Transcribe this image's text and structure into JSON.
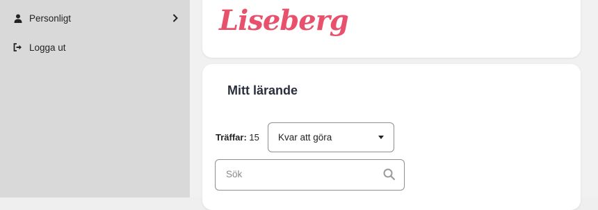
{
  "sidebar": {
    "items": [
      {
        "label": "Personligt",
        "icon": "user-icon"
      },
      {
        "label": "Logga ut",
        "icon": "sign-out-icon"
      }
    ]
  },
  "brand": {
    "logo_text": "Liseberg",
    "color": "#e8516b"
  },
  "main": {
    "title": "Mitt lärande",
    "hits_label": "Träffar:",
    "hits_count": "15",
    "filter": {
      "selected": "Kvar att göra"
    },
    "search": {
      "placeholder": "Sök"
    }
  }
}
